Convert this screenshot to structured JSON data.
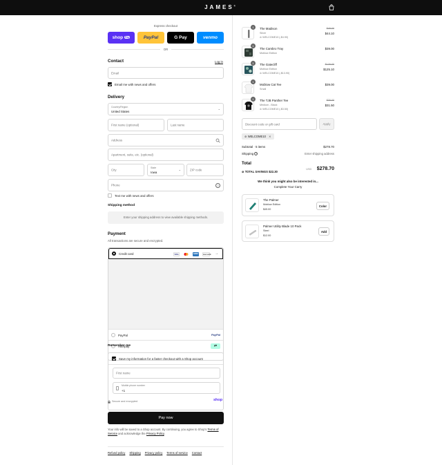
{
  "header": {
    "brand": "JAMES",
    "brand_mark": "®"
  },
  "express": {
    "title": "Express checkout",
    "buttons": [
      {
        "label": "shop",
        "badge": "Pay",
        "color": "#5a31f4"
      },
      {
        "label": "PayPal",
        "color": "#ffc439"
      },
      {
        "label": "G Pay",
        "color": "#000000"
      },
      {
        "label": "venmo",
        "color": "#008cff"
      }
    ],
    "or": "OR"
  },
  "contact": {
    "title": "Contact",
    "login": "Log in",
    "email_placeholder": "Email",
    "news_label": "Email me with news and offers",
    "news_checked": true
  },
  "delivery": {
    "title": "Delivery",
    "country_label": "Country/Region",
    "country_value": "United States",
    "first_name": "First name (optional)",
    "last_name": "Last name",
    "address": "Address",
    "apartment": "Apartment, suite, etc. (optional)",
    "city": "City",
    "state_label": "State",
    "state_value": "Iowa",
    "zip": "ZIP code",
    "phone": "Phone",
    "text_label": "Text me with news and offers",
    "text_checked": false
  },
  "shipping_method": {
    "title": "Shipping method",
    "message": "Enter your shipping address to view available shipping methods."
  },
  "payment": {
    "title": "Payment",
    "subtitle": "All transactions are secure and encrypted.",
    "credit_card": "Credit card",
    "cards": [
      "VISA",
      "MC",
      "AMEX",
      "DISCOVER"
    ],
    "more": "→",
    "paypal": "PayPal",
    "paypal_logo": "PayPal",
    "afterpay": "Afterpay"
  },
  "remember": {
    "title": "Remember me",
    "save_label": "Save my information for a faster checkout with a Shop account",
    "first_name": "First name",
    "mobile_label": "Mobile phone number",
    "mobile_value": "+1",
    "secure": "Secure and encrypted",
    "shop_logo": "shop"
  },
  "pay_now": "Pay now",
  "disclaimer_pre": "Your info will be saved to a Shop account. By continuing, you agree to Shop's",
  "terms_link": "Terms of Service",
  "disclaimer_mid": "and acknowledge the",
  "privacy_link": "Privacy Policy",
  "disclaimer_end": ".",
  "footer_links": [
    "Refund policy",
    "Shipping",
    "Privacy policy",
    "Terms of service",
    "Contact"
  ],
  "cart": {
    "items": [
      {
        "name": "The Madison",
        "variant": "Silver",
        "discount": "WELCOME10 (-$4.90)",
        "old_price": "$49.00",
        "price": "$44.10",
        "qty": "1"
      },
      {
        "name": "The Cambro Tray",
        "variant": "Moblow Edition",
        "discount": "",
        "old_price": "",
        "price": "$39.00",
        "qty": "1"
      },
      {
        "name": "The Gatecliff",
        "variant": "Moblow Edition",
        "discount": "WELCOME10 (-$13.90)",
        "old_price": "$139.00",
        "price": "$125.10",
        "qty": "1"
      },
      {
        "name": "Moblow Cat Tee",
        "variant": "Small",
        "discount": "",
        "old_price": "",
        "price": "$39.00",
        "qty": "1"
      },
      {
        "name": "The TJB Panther Tee",
        "variant": "Medium - Black",
        "discount": "WELCOME10 (-$3.50)",
        "old_price": "$35.00",
        "price": "$31.50",
        "qty": "1"
      }
    ],
    "discount_placeholder": "Discount code or gift card",
    "apply": "Apply",
    "applied_code": "WELCOME10",
    "subtotal_label": "Subtotal · 5 items",
    "subtotal_value": "$278.70",
    "shipping_label": "Shipping",
    "shipping_value": "Enter shipping address",
    "total_label": "Total",
    "currency": "USD",
    "total_value": "$278.70",
    "savings_label": "TOTAL SAVINGS",
    "savings_value": "$22.30"
  },
  "recommendations": {
    "title": "We think you might also be interested in...",
    "subtitle": "Complete Your Carry",
    "items": [
      {
        "name": "The Palmer",
        "variant": "Moblow Edition",
        "price": "$45.00",
        "action": "Color"
      },
      {
        "name": "Palmer Utility Blade 10 Pack",
        "variant": "Steel",
        "price": "$12.00",
        "action": "Add"
      }
    ]
  }
}
